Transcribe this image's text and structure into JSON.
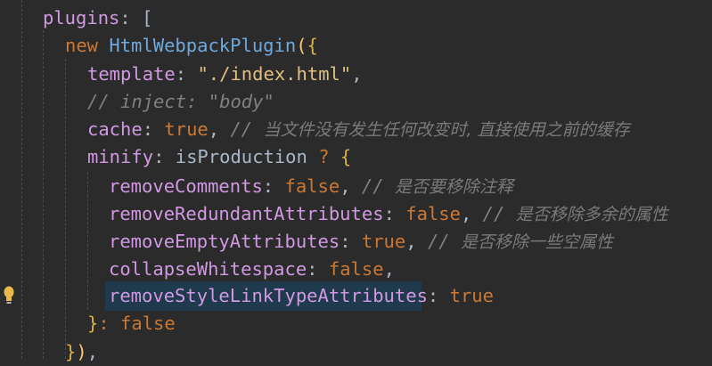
{
  "code": {
    "plugins_key": "plugins",
    "plugins_open": ": [",
    "new_kw": "new",
    "plugin_class": "HtmlWebpackPlugin",
    "plugin_open_paren": "(",
    "plugin_open_brace": "{",
    "template_key": "template",
    "template_value": "\"./index.html\"",
    "inject_comment": "// inject: \"body\"",
    "cache_key": "cache",
    "cache_value": "true",
    "cache_comment_slashes": "//",
    "cache_comment_text": "当文件没有发生任何改变时, 直接使用之前的缓存",
    "minify_key": "minify",
    "minify_condition": "isProduction",
    "ternary_q": "?",
    "ternary_colon": ":",
    "minify_open_brace": "{",
    "remove_comments_key": "removeComments",
    "remove_comments_value": "false",
    "remove_comments_comment_slashes": "//",
    "remove_comments_comment_text": "是否要移除注释",
    "remove_redundant_key": "removeRedundantAttributes",
    "remove_redundant_value": "false",
    "remove_redundant_comment_slashes": "//",
    "remove_redundant_comment_text": "是否移除多余的属性",
    "remove_empty_key": "removeEmptyAttributes",
    "remove_empty_value": "true",
    "remove_empty_comment_slashes": "//",
    "remove_empty_comment_text": "是否移除一些空属性",
    "collapse_ws_key": "collapseWhitespace",
    "collapse_ws_value": "false",
    "remove_style_key": "removeStyleLinkTypeAttributes",
    "remove_style_value": "true",
    "minify_close_brace": "}",
    "minify_else_value": "false",
    "plugin_close_brace": "}",
    "plugin_close_paren": ")",
    "trailing_comma": ","
  },
  "icons": {
    "intention_bulb": "lightbulb-icon"
  },
  "colors": {
    "background": "#2b2b2b",
    "property": "#d199e2",
    "keyword": "#cc7832",
    "class_name": "#6fa8dc",
    "string": "#e0c080",
    "comment": "#808080",
    "selection": "#1e3a4c"
  }
}
